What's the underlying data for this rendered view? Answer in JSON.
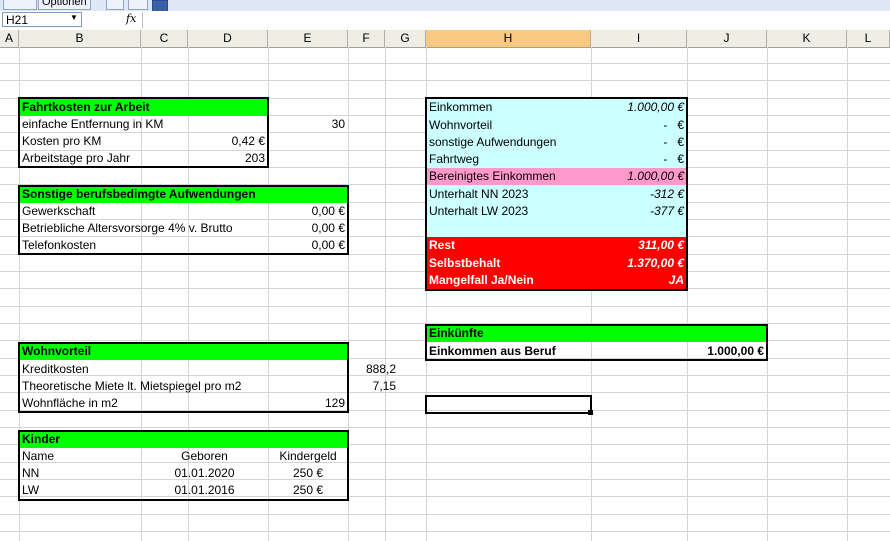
{
  "toolbar": {
    "options_label": "Optionen"
  },
  "formula_bar": {
    "cell_ref": "H21",
    "fx_label": "fx",
    "formula": ""
  },
  "columns": [
    "A",
    "B",
    "C",
    "D",
    "E",
    "F",
    "G",
    "H",
    "I",
    "J",
    "K",
    "L"
  ],
  "selected_column": "H",
  "fahrtkosten": {
    "header": "Fahrtkosten zur Arbeit",
    "rows": [
      {
        "label": "einfache Entfernung in KM",
        "value": "30"
      },
      {
        "label": "Kosten pro KM",
        "value": "0,42 €"
      },
      {
        "label": "Arbeitstage pro Jahr",
        "value": "203"
      }
    ]
  },
  "sonstige": {
    "header": "Sonstige berufsbedimgte Aufwendungen",
    "rows": [
      {
        "label": "Gewerkschaft",
        "value": "0,00 €"
      },
      {
        "label": "Betriebliche Altersvorsorge 4% v. Brutto",
        "value": "0,00 €"
      },
      {
        "label": "Telefonkosten",
        "value": "0,00 €"
      }
    ]
  },
  "wohnvorteil": {
    "header": "Wohnvorteil",
    "rows": [
      {
        "label": "Kreditkosten",
        "value": "",
        "extra": "888,2"
      },
      {
        "label": "Theoretische Miete lt. Mietspiegel pro m2",
        "value": "",
        "extra": "7,15"
      },
      {
        "label": "Wohnfläche in m2",
        "value": "129",
        "extra": ""
      }
    ]
  },
  "kinder": {
    "header": "Kinder",
    "columns": [
      "Name",
      "Geboren",
      "Kindergeld"
    ],
    "rows": [
      {
        "name": "NN",
        "born": "01.01.2020",
        "kg": "250 €"
      },
      {
        "name": "LW",
        "born": "01.01.2016",
        "kg": "250 €"
      }
    ]
  },
  "summary": {
    "rows": [
      {
        "label": "Einkommen",
        "value": "1.000,00 €"
      },
      {
        "label": "Wohnvorteil",
        "value": "-   €"
      },
      {
        "label": "sonstige Aufwendungen",
        "value": "-   €"
      },
      {
        "label": "Fahrtweg",
        "value": "-   €"
      },
      {
        "label": "Bereinigtes Einkommen",
        "value": "1.000,00 €"
      },
      {
        "label": "Unterhalt NN 2023",
        "value": "-312 €"
      },
      {
        "label": "Unterhalt LW 2023",
        "value": "-377 €"
      }
    ],
    "red_rows": [
      {
        "label": "Rest",
        "value": "311,00 €"
      },
      {
        "label": "Selbstbehalt",
        "value": "1.370,00 €"
      },
      {
        "label": "Mangelfall Ja/Nein",
        "value": "JA"
      }
    ]
  },
  "einkuenfte": {
    "header": "Einkünfte",
    "label": "Einkommen aus Beruf",
    "value": "1.000,00 €"
  },
  "colors": {
    "green": "#00ff00",
    "cyan": "#ccffff",
    "pink": "#ff99cc",
    "red": "#ff0000"
  }
}
